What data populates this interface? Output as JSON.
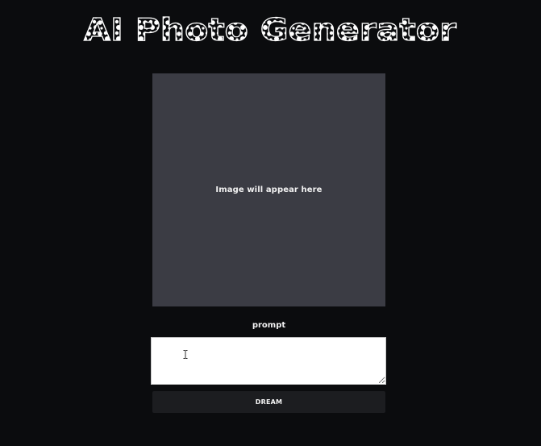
{
  "header": {
    "title": "AI Photo Generator"
  },
  "preview": {
    "placeholder": "Image will appear here"
  },
  "prompt": {
    "label": "prompt",
    "value": "",
    "placeholder": ""
  },
  "actions": {
    "dream_label": "DREAM"
  },
  "colors": {
    "background": "#0b0c0e",
    "placeholder_panel": "#3b3c44",
    "button": "#1c1d20",
    "text": "#ffffff"
  }
}
